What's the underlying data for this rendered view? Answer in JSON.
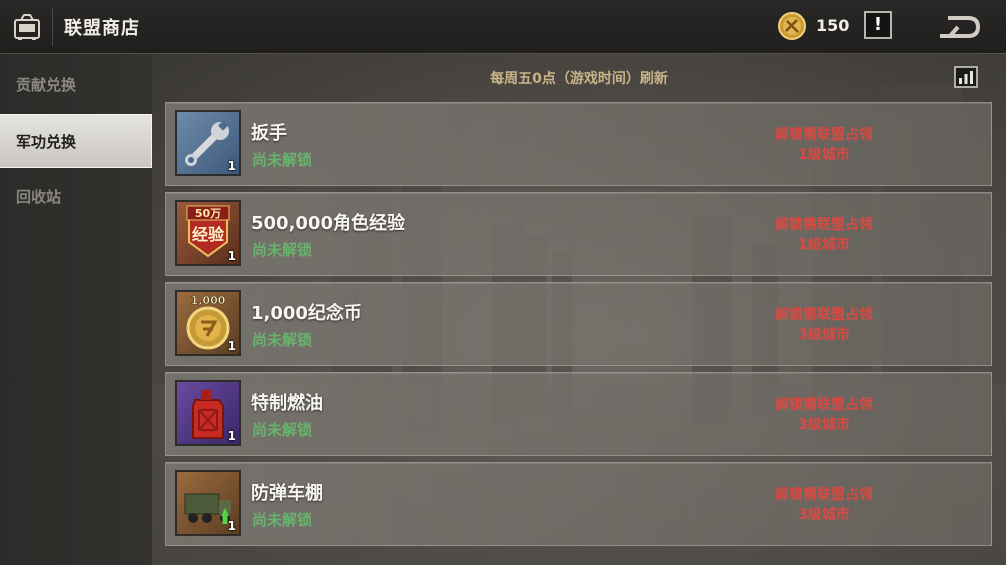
{
  "header": {
    "title": "联盟商店",
    "currency_count": "150",
    "info_label": "!"
  },
  "sidebar": {
    "items": [
      {
        "label": "贡献兑换",
        "active": false
      },
      {
        "label": "军功兑换",
        "active": true
      },
      {
        "label": "回收站",
        "active": false
      }
    ]
  },
  "main": {
    "refresh_note": "每周五0点（游戏时间）刷新",
    "items": [
      {
        "name": "扳手",
        "quantity": "1",
        "status": "尚未解锁",
        "req_line1": "解锁需联盟占领",
        "req_line2": "1级城市",
        "icon": "wrench-icon",
        "badge": ""
      },
      {
        "name": "500,000角色经验",
        "quantity": "1",
        "status": "尚未解锁",
        "req_line1": "解锁需联盟占领",
        "req_line2": "1级城市",
        "icon": "exp-badge-icon",
        "badge": "50万",
        "badge_sub": "经验"
      },
      {
        "name": "1,000纪念币",
        "quantity": "1",
        "status": "尚未解锁",
        "req_line1": "解锁需联盟占领",
        "req_line2": "3级城市",
        "icon": "memorial-coin-icon",
        "badge": "1,000"
      },
      {
        "name": "特制燃油",
        "quantity": "1",
        "status": "尚未解锁",
        "req_line1": "解锁需联盟占领",
        "req_line2": "3级城市",
        "icon": "fuel-can-icon",
        "badge": ""
      },
      {
        "name": "防弹车棚",
        "quantity": "1",
        "status": "尚未解锁",
        "req_line1": "解锁需联盟占领",
        "req_line2": "3级城市",
        "icon": "armored-truck-icon",
        "badge": ""
      }
    ]
  },
  "colors": {
    "status_locked": "#69b26e",
    "unlock_requirement": "#d84a42",
    "refresh_note": "#c8b488"
  }
}
